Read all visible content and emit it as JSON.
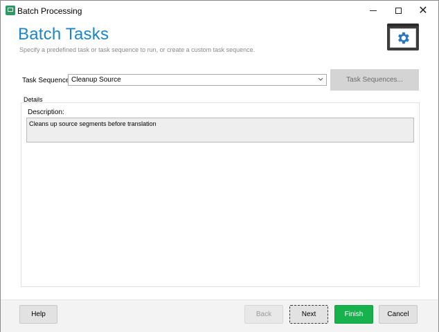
{
  "window": {
    "title": "Batch Processing",
    "app_icon": "batch-processing-app-icon",
    "controls": {
      "minimize": "minimize-icon",
      "maximize": "maximize-icon",
      "close": "close-icon"
    }
  },
  "header": {
    "title": "Batch Tasks",
    "subtitle": "Specify a predefined task or task sequence to run, or create a custom task sequence.",
    "badge_icon": "gear-icon"
  },
  "task_sequence": {
    "label": "Task Sequence:",
    "selected": "Cleanup Source",
    "button_label": "Task Sequences..."
  },
  "details": {
    "group_label": "Details",
    "description_label": "Description:",
    "description": "Cleans up source segments before translation"
  },
  "footer": {
    "help": "Help",
    "back": "Back",
    "next": "Next",
    "finish": "Finish",
    "cancel": "Cancel"
  },
  "colors": {
    "title_blue": "#1a86c8",
    "finish_green": "#17b24d",
    "badge_dark": "#3c3c3c",
    "gear_blue": "#2b78c2"
  }
}
